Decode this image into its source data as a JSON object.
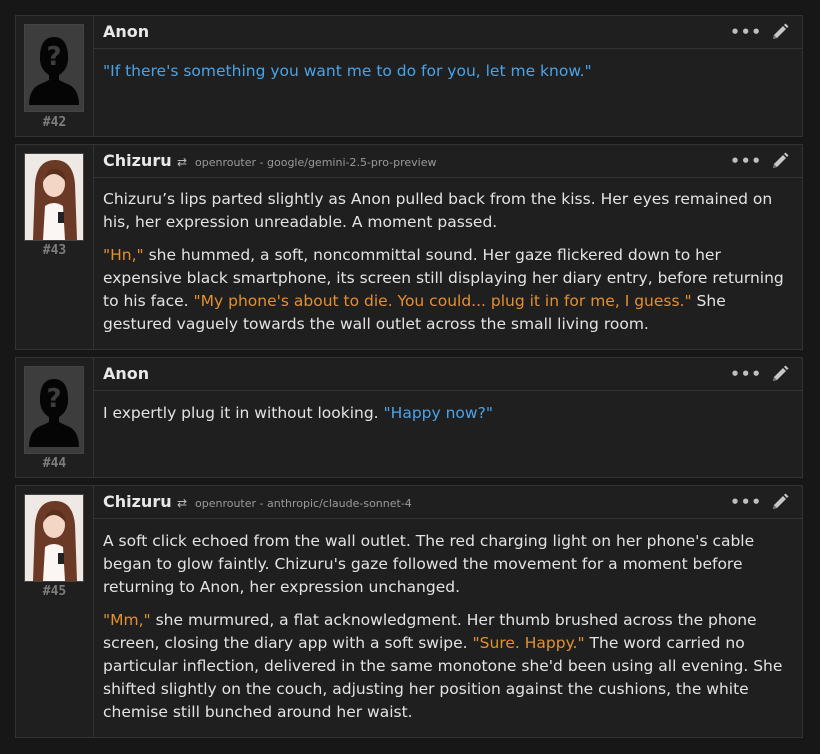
{
  "colors": {
    "background": "#171717",
    "card": "#1f1f1f",
    "border": "#333333",
    "user_quote": "#4aa3e8",
    "char_quote": "#e4902e",
    "text": "#e3e3e3"
  },
  "icons": {
    "more": "more-options-icon",
    "edit": "pencil-icon",
    "model": "shuffle-icon",
    "user_avatar": "unknown-user-silhouette",
    "char_avatar": "character-portrait"
  },
  "messages": [
    {
      "author": "Anon",
      "number": "#42",
      "more": "•••",
      "paragraphs": [
        [
          {
            "text": "\"If there's something you want me to do for you, let me know.\"",
            "style": "blue"
          }
        ]
      ]
    },
    {
      "author": "Chizuru",
      "number": "#43",
      "model": "openrouter - google/gemini-2.5-pro-preview",
      "more": "•••",
      "paragraphs": [
        [
          {
            "text": "Chizuru’s lips parted slightly as Anon pulled back from the kiss. Her eyes remained on his, her expression unreadable. A moment passed.",
            "style": "plain"
          }
        ],
        [
          {
            "text": "\"Hn,\"",
            "style": "orange"
          },
          {
            "text": " she hummed, a soft, noncommittal sound. Her gaze flickered down to her expensive black smartphone, its screen still displaying her diary entry, before returning to his face. ",
            "style": "plain"
          },
          {
            "text": "\"My phone's about to die. You could... plug it in for me, I guess.\"",
            "style": "orange"
          },
          {
            "text": " She gestured vaguely towards the wall outlet across the small living room.",
            "style": "plain"
          }
        ]
      ]
    },
    {
      "author": "Anon",
      "number": "#44",
      "more": "•••",
      "paragraphs": [
        [
          {
            "text": "I expertly plug it in without looking. ",
            "style": "plain"
          },
          {
            "text": "\"Happy now?\"",
            "style": "blue"
          }
        ]
      ]
    },
    {
      "author": "Chizuru",
      "number": "#45",
      "model": "openrouter - anthropic/claude-sonnet-4",
      "more": "•••",
      "paragraphs": [
        [
          {
            "text": "A soft click echoed from the wall outlet. The red charging light on her phone's cable began to glow faintly. Chizuru's gaze followed the movement for a moment before returning to Anon, her expression unchanged.",
            "style": "plain"
          }
        ],
        [
          {
            "text": "\"Mm,\"",
            "style": "orange"
          },
          {
            "text": " she murmured, a flat acknowledgment. Her thumb brushed across the phone screen, closing the diary app with a soft swipe. ",
            "style": "plain"
          },
          {
            "text": "\"Sure. Happy.\"",
            "style": "orange"
          },
          {
            "text": " The word carried no particular inflection, delivered in the same monotone she'd been using all evening. She shifted slightly on the couch, adjusting her position against the cushions, the white chemise still bunched around her waist.",
            "style": "plain"
          }
        ]
      ]
    }
  ]
}
